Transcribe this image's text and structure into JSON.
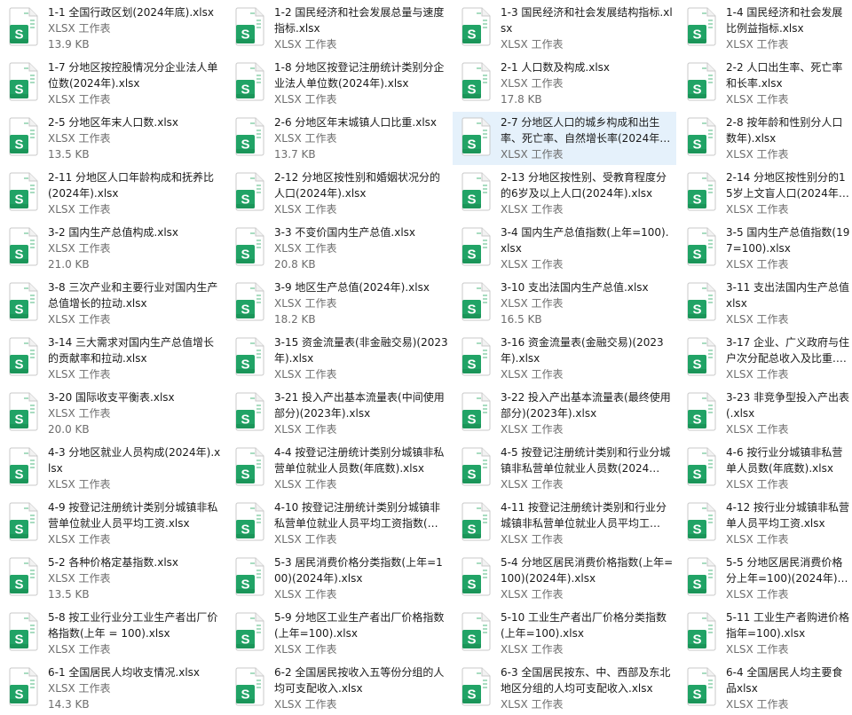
{
  "icon": {
    "name": "excel-spreadsheet-icon",
    "letter": "S",
    "color": "#21a366",
    "color_dark": "#107c41",
    "color_light": "#a8dcc0"
  },
  "accent": {
    "selection": "#e5f1fb"
  },
  "files": [
    {
      "name": "1-1 全国行政区划(2024年底).xlsx",
      "type": "XLSX 工作表",
      "size": "13.9 KB"
    },
    {
      "name": "1-2 国民经济和社会发展总量与速度指标.xlsx",
      "type": "XLSX 工作表"
    },
    {
      "name": "1-3 国民经济和社会发展结构指标.xlsx",
      "type": "XLSX 工作表"
    },
    {
      "name": "1-4 国民经济和社会发展比例益指标.xlsx",
      "type": "XLSX 工作表"
    },
    {
      "name": "1-7 分地区按控股情况分企业法人单位数(2024年).xlsx",
      "type": "XLSX 工作表"
    },
    {
      "name": "1-8 分地区按登记注册统计类别分企业法人单位数(2024年).xlsx",
      "type": "XLSX 工作表"
    },
    {
      "name": "2-1 人口数及构成.xlsx",
      "type": "XLSX 工作表",
      "size": "17.8 KB"
    },
    {
      "name": "2-2 人口出生率、死亡率和长率.xlsx",
      "type": "XLSX 工作表"
    },
    {
      "name": "2-5 分地区年末人口数.xlsx",
      "type": "XLSX 工作表",
      "size": "13.5 KB"
    },
    {
      "name": "2-6 分地区年末城镇人口比重.xlsx",
      "type": "XLSX 工作表",
      "size": "13.7 KB"
    },
    {
      "name": "2-7 分地区人口的城乡构成和出生率、死亡率、自然增长率(2024年…",
      "type": "XLSX 工作表",
      "selected": true
    },
    {
      "name": "2-8 按年龄和性别分人口数年).xlsx",
      "type": "XLSX 工作表"
    },
    {
      "name": "2-11 分地区人口年龄构成和抚养比(2024年).xlsx",
      "type": "XLSX 工作表"
    },
    {
      "name": "2-12 分地区按性别和婚姻状况分的人口(2024年).xlsx",
      "type": "XLSX 工作表"
    },
    {
      "name": "2-13 分地区按性别、受教育程度分的6岁及以上人口(2024年).xlsx",
      "type": "XLSX 工作表"
    },
    {
      "name": "2-14 分地区按性别分的15岁上文盲人口(2024年).xlsx",
      "type": "XLSX 工作表"
    },
    {
      "name": "3-2 国内生产总值构成.xlsx",
      "type": "XLSX 工作表",
      "size": "21.0 KB"
    },
    {
      "name": "3-3 不变价国内生产总值.xlsx",
      "type": "XLSX 工作表",
      "size": "20.8 KB"
    },
    {
      "name": "3-4 国内生产总值指数(上年=100).xlsx",
      "type": "XLSX 工作表"
    },
    {
      "name": "3-5 国内生产总值指数(197=100).xlsx",
      "type": "XLSX 工作表"
    },
    {
      "name": "3-8 三次产业和主要行业对国内生产总值增长的拉动.xlsx",
      "type": "XLSX 工作表"
    },
    {
      "name": "3-9 地区生产总值(2024年).xlsx",
      "type": "XLSX 工作表",
      "size": "18.2 KB"
    },
    {
      "name": "3-10 支出法国内生产总值.xlsx",
      "type": "XLSX 工作表",
      "size": "16.5 KB"
    },
    {
      "name": "3-11 支出法国内生产总值xlsx",
      "type": "XLSX 工作表"
    },
    {
      "name": "3-14 三大需求对国内生产总值增长的贡献率和拉动.xlsx",
      "type": "XLSX 工作表"
    },
    {
      "name": "3-15 资金流量表(非金融交易)(2023年).xlsx",
      "type": "XLSX 工作表"
    },
    {
      "name": "3-16 资金流量表(金融交易)(2023年).xlsx",
      "type": "XLSX 工作表"
    },
    {
      "name": "3-17 企业、广义政府与住户次分配总收入及比重.xlsx",
      "type": "XLSX 工作表"
    },
    {
      "name": "3-20 国际收支平衡表.xlsx",
      "type": "XLSX 工作表",
      "size": "20.0 KB"
    },
    {
      "name": "3-21 投入产出基本流量表(中间使用部分)(2023年).xlsx",
      "type": "XLSX 工作表"
    },
    {
      "name": "3-22 投入产出基本流量表(最终使用部分)(2023年).xlsx",
      "type": "XLSX 工作表"
    },
    {
      "name": "3-23 非竞争型投入产出表(.xlsx",
      "type": "XLSX 工作表"
    },
    {
      "name": "4-3 分地区就业人员构成(2024年).xlsx",
      "type": "XLSX 工作表"
    },
    {
      "name": "4-4 按登记注册统计类别分城镇非私营单位就业人员数(年底数).xlsx",
      "type": "XLSX 工作表"
    },
    {
      "name": "4-5 按登记注册统计类别和行业分城镇非私营单位就业人员数(2024…",
      "type": "XLSX 工作表"
    },
    {
      "name": "4-6 按行业分城镇非私营单人员数(年底数).xlsx",
      "type": "XLSX 工作表"
    },
    {
      "name": "4-9 按登记注册统计类别分城镇非私营单位就业人员平均工资.xlsx",
      "type": "XLSX 工作表"
    },
    {
      "name": "4-10 按登记注册统计类别分城镇非私营单位就业人员平均工资指数(…",
      "type": "XLSX 工作表"
    },
    {
      "name": "4-11 按登记注册统计类别和行业分城镇非私营单位就业人员平均工…",
      "type": "XLSX 工作表"
    },
    {
      "name": "4-12 按行业分城镇非私营单人员平均工资.xlsx",
      "type": "XLSX 工作表"
    },
    {
      "name": "5-2 各种价格定基指数.xlsx",
      "type": "XLSX 工作表",
      "size": "13.5 KB"
    },
    {
      "name": "5-3 居民消费价格分类指数(上年=100)(2024年).xlsx",
      "type": "XLSX 工作表"
    },
    {
      "name": "5-4 分地区居民消费价格指数(上年=100)(2024年).xlsx",
      "type": "XLSX 工作表"
    },
    {
      "name": "5-5 分地区居民消费价格分上年=100)(2024年).xlsx",
      "type": "XLSX 工作表"
    },
    {
      "name": "5-8 按工业行业分工业生产者出厂价格指数(上年 = 100).xlsx",
      "type": "XLSX 工作表"
    },
    {
      "name": "5-9 分地区工业生产者出厂价格指数(上年=100).xlsx",
      "type": "XLSX 工作表"
    },
    {
      "name": "5-10 工业生产者出厂价格分类指数(上年=100).xlsx",
      "type": "XLSX 工作表"
    },
    {
      "name": "5-11 工业生产者购进价格指年=100).xlsx",
      "type": "XLSX 工作表"
    },
    {
      "name": "6-1 全国居民人均收支情况.xlsx",
      "type": "XLSX 工作表",
      "size": "14.3 KB"
    },
    {
      "name": "6-2 全国居民按收入五等份分组的人均可支配收入.xlsx",
      "type": "XLSX 工作表"
    },
    {
      "name": "6-3 全国居民按东、中、西部及东北地区分组的人均可支配收入.xlsx",
      "type": "XLSX 工作表"
    },
    {
      "name": "6-4 全国居民人均主要食品xlsx",
      "type": "XLSX 工作表"
    }
  ]
}
